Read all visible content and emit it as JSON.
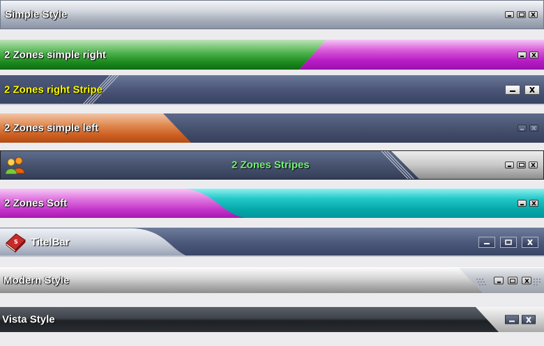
{
  "bars": [
    {
      "title": "Simple Style"
    },
    {
      "title": "2 Zones simple right"
    },
    {
      "title": "2 Zones right Stripe"
    },
    {
      "title": "2 Zones simple left"
    },
    {
      "title": "2 Zones Stripes"
    },
    {
      "title": "2 Zones Soft"
    },
    {
      "title": "TitelBar"
    },
    {
      "title": "Modern Style"
    },
    {
      "title": "Vista Style"
    }
  ],
  "colors": {
    "stripe_title": "#ffff00",
    "stripes_title": "#74f174"
  }
}
